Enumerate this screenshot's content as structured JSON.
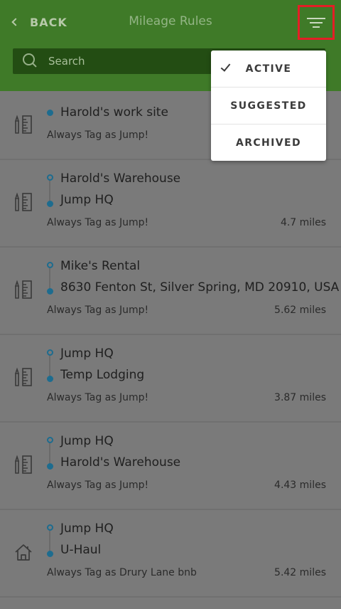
{
  "header": {
    "back_label": "BACK",
    "title": "Mileage Rules",
    "filter_icon": "filter-icon"
  },
  "search": {
    "placeholder": "Search",
    "value": ""
  },
  "filter_menu": {
    "items": [
      {
        "label": "ACTIVE",
        "selected": true
      },
      {
        "label": "SUGGESTED",
        "selected": false
      },
      {
        "label": "ARCHIVED",
        "selected": false
      }
    ]
  },
  "rules": [
    {
      "type": "single",
      "icon": "pencil-ruler-icon",
      "location": "Harold's work site",
      "tag": "Always Tag as Jump!"
    },
    {
      "type": "route",
      "icon": "pencil-ruler-icon",
      "from": "Harold's Warehouse",
      "to": "Jump HQ",
      "tag": "Always Tag as Jump!",
      "miles": "4.7 miles"
    },
    {
      "type": "route",
      "icon": "pencil-ruler-icon",
      "from": "Mike's Rental",
      "to": "8630 Fenton St, Silver Spring, MD 20910, USA",
      "tag": "Always Tag as Jump!",
      "miles": "5.62 miles"
    },
    {
      "type": "route",
      "icon": "pencil-ruler-icon",
      "from": "Jump HQ",
      "to": "Temp Lodging",
      "tag": "Always Tag as Jump!",
      "miles": "3.87 miles"
    },
    {
      "type": "route",
      "icon": "pencil-ruler-icon",
      "from": "Jump HQ",
      "to": "Harold's Warehouse",
      "tag": "Always Tag as Jump!",
      "miles": "4.43 miles"
    },
    {
      "type": "route",
      "icon": "house-icon",
      "from": "Jump HQ",
      "to": "U-Haul",
      "tag": "Always Tag as Drury Lane bnb",
      "miles": "5.42 miles"
    }
  ],
  "colors": {
    "header_green": "#3f7a28",
    "search_green": "#234d13",
    "overlay_gray": "#7a7a7a",
    "route_blue": "#1d6c8f",
    "highlight_red": "#e41e26"
  }
}
